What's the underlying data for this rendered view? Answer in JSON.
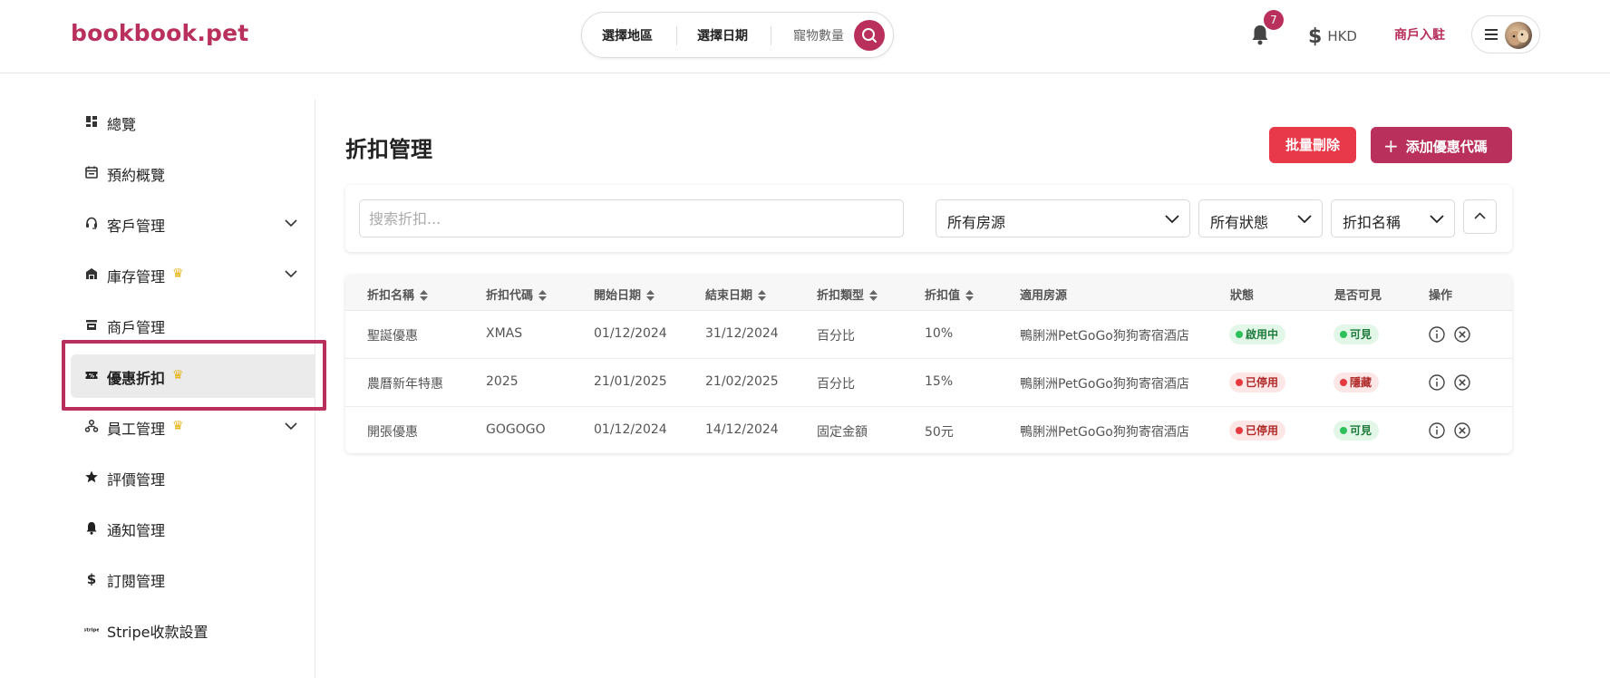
{
  "header": {
    "logo": "bookbook.pet",
    "search": {
      "region": "選擇地區",
      "date": "選擇日期",
      "pets": "寵物數量"
    },
    "notification_count": "7",
    "currency": "HKD",
    "merchant_link": "商戶入駐"
  },
  "sidebar": {
    "items": [
      {
        "label": "總覽",
        "icon": "dashboard-icon"
      },
      {
        "label": "預約概覽",
        "icon": "calendar-icon"
      },
      {
        "label": "客戶管理",
        "icon": "headset-icon",
        "expandable": true
      },
      {
        "label": "庫存管理",
        "icon": "store-icon",
        "premium": true,
        "expandable": true
      },
      {
        "label": "商戶管理",
        "icon": "shop-icon"
      },
      {
        "label": "優惠折扣",
        "icon": "ticket-icon",
        "premium": true,
        "active": true
      },
      {
        "label": "員工管理",
        "icon": "team-icon",
        "premium": true,
        "expandable": true
      },
      {
        "label": "評價管理",
        "icon": "star-icon"
      },
      {
        "label": "通知管理",
        "icon": "bell-icon"
      },
      {
        "label": "訂閱管理",
        "icon": "dollar-icon"
      },
      {
        "label": "Stripe收款設置",
        "icon": "stripe-icon"
      }
    ]
  },
  "main": {
    "title": "折扣管理",
    "batch_delete": "批量刪除",
    "add_code": "添加優惠代碼",
    "filters": {
      "search_placeholder": "搜索折扣...",
      "property": "所有房源",
      "status": "所有狀態",
      "sort": "折扣名稱"
    },
    "table": {
      "headers": [
        "折扣名稱",
        "折扣代碼",
        "開始日期",
        "結束日期",
        "折扣類型",
        "折扣值",
        "適用房源",
        "狀態",
        "是否可見",
        "操作"
      ],
      "rows": [
        {
          "name": "聖誕優惠",
          "code": "XMAS",
          "start": "01/12/2024",
          "end": "31/12/2024",
          "type": "百分比",
          "value": "10%",
          "property": "鴨脷洲PetGoGo狗狗寄宿酒店",
          "status": "啟用中",
          "status_color": "green",
          "visible": "可見",
          "visible_color": "green"
        },
        {
          "name": "農曆新年特惠",
          "code": "2025",
          "start": "21/01/2025",
          "end": "21/02/2025",
          "type": "百分比",
          "value": "15%",
          "property": "鴨脷洲PetGoGo狗狗寄宿酒店",
          "status": "已停用",
          "status_color": "red",
          "visible": "隱藏",
          "visible_color": "red"
        },
        {
          "name": "開張優惠",
          "code": "GOGOGO",
          "start": "01/12/2024",
          "end": "14/12/2024",
          "type": "固定金額",
          "value": "50元",
          "property": "鴨脷洲PetGoGo狗狗寄宿酒店",
          "status": "已停用",
          "status_color": "red",
          "visible": "可見",
          "visible_color": "green"
        }
      ]
    }
  },
  "colors": {
    "brand": "#b8305b",
    "danger": "#e8394a",
    "crown": "#e7b419"
  }
}
